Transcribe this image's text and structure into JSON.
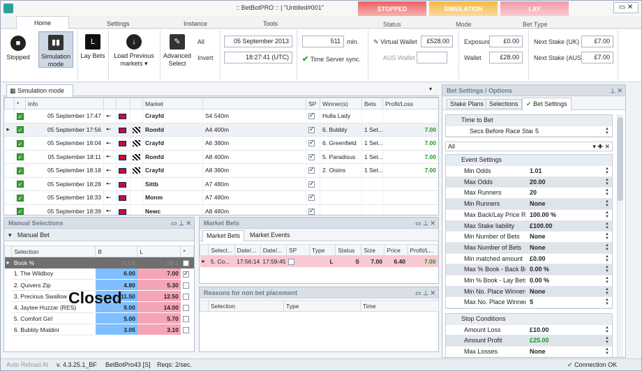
{
  "window": {
    "title": ":: BetBotPRO :: | \"Untitled#001\""
  },
  "context_tabs": [
    {
      "label": "STOPPED",
      "color": "#d94b4b",
      "group": "Status"
    },
    {
      "label": "SIMULATION",
      "color": "#f2b640",
      "group": "Mode"
    },
    {
      "label": "LAY",
      "color": "#f0a0aa",
      "group": "Bet Type"
    }
  ],
  "ribbon_tabs": [
    "Home",
    "Settings",
    "Instance",
    "Tools"
  ],
  "buttons": {
    "stopped": "Stopped",
    "simulation": "Simulation mode",
    "lay_bets": "Lay Bets",
    "load_previous": "Load Previous markets",
    "advanced_select": "Advanced Select",
    "all": "All",
    "invert": "Invert"
  },
  "datetime": {
    "date": "05 September 2013",
    "time": "18:27:41 (UTC)",
    "minutes": "511",
    "min_label": "min.",
    "time_sync": "Time Server sync."
  },
  "wallet": {
    "virtual_label": "Virtual Wallet",
    "virtual_value": "£528.00",
    "aus_label": "AUS Wallet",
    "aus_value": "",
    "exposure_label": "Exposure",
    "exposure_value": "£0.00",
    "wallet_label": "Wallet",
    "wallet_value": "£28.00"
  },
  "stake": {
    "uk_label": "Next Stake (UK)",
    "uk_value": "£7.00",
    "aus_label": "Next Stake (AUS)",
    "aus_value": "£7.00"
  },
  "markets_panel": {
    "tab": "Simulation mode",
    "headers": [
      "*",
      "Info",
      "",
      "",
      "",
      "Market",
      "",
      "SP",
      "Winner(s)",
      "Bets",
      "Profit/Loss"
    ],
    "rows": [
      {
        "info": "05 September 17:47",
        "flag2": false,
        "market": "Crayfd",
        "desc": "S4 540m",
        "sp": true,
        "winner": "Hulla Lady",
        "bets": "",
        "pl": "",
        "sel": false
      },
      {
        "info": "05 September 17:56",
        "flag2": true,
        "market": "Romfd",
        "desc": "A4 400m",
        "sp": true,
        "winner": "6. Bubbly",
        "bets": "1 Set...",
        "pl": "7.00",
        "sel": true
      },
      {
        "info": "05 September 18:04",
        "flag2": true,
        "market": "Crayfd",
        "desc": "A6 380m",
        "sp": true,
        "winner": "6. Greenfield",
        "bets": "1 Set...",
        "pl": "7.00",
        "sel": false
      },
      {
        "info": "05 September 18:11",
        "flag2": true,
        "market": "Romfd",
        "desc": "A8 400m",
        "sp": true,
        "winner": "5. Paradisus",
        "bets": "1 Set...",
        "pl": "7.00",
        "sel": false
      },
      {
        "info": "05 September 18:18",
        "flag2": true,
        "market": "Crayfd",
        "desc": "A8 380m",
        "sp": true,
        "winner": "2. Oisins",
        "bets": "1 Set...",
        "pl": "7.00",
        "sel": false
      },
      {
        "info": "05 September 18:28",
        "flag2": false,
        "market": "Sittb",
        "desc": "A7 480m",
        "sp": true,
        "winner": "",
        "bets": "",
        "pl": "",
        "sel": false
      },
      {
        "info": "05 September 18:33",
        "flag2": false,
        "market": "Monm",
        "desc": "A7 480m",
        "sp": true,
        "winner": "",
        "bets": "",
        "pl": "",
        "sel": false
      },
      {
        "info": "05 September 18:39",
        "flag2": false,
        "market": "Newc",
        "desc": "A8 480m",
        "sp": true,
        "winner": "",
        "bets": "",
        "pl": "",
        "sel": false
      }
    ]
  },
  "manual": {
    "title": "Manual Selections",
    "subtitle": "Manual Bet",
    "headers": [
      "Selection",
      "B",
      "L",
      "*"
    ],
    "book": {
      "label": "Book %",
      "b": "111.8",
      "l": "96.1"
    },
    "rows": [
      {
        "name": "1. The Wildboy",
        "b": "6.00",
        "l": "7.00",
        "checked": true
      },
      {
        "name": "2. Quivers Zip",
        "b": "4.80",
        "l": "5.30",
        "checked": false
      },
      {
        "name": "3. Precious Swallow",
        "b": "11.50",
        "l": "12.50",
        "checked": false
      },
      {
        "name": "4. Jaytee Huzzar (RES)",
        "b": "9.00",
        "l": "14.00",
        "checked": false
      },
      {
        "name": "5. Comfort Girl",
        "b": "5.00",
        "l": "5.70",
        "checked": false
      },
      {
        "name": "6. Bubbly Maldini",
        "b": "3.05",
        "l": "3.10",
        "checked": false
      }
    ],
    "overlay": "Closed"
  },
  "market_bets": {
    "title": "Market Bets",
    "tabs": [
      "Market Bets",
      "Market Events"
    ],
    "headers": [
      "Select...",
      "Date/...",
      "Date/...",
      "SP",
      "Type",
      "Status",
      "Size",
      "Price",
      "Profit/L..."
    ],
    "row": {
      "sel": "5. Co...",
      "d1": "17:56:14",
      "d2": "17:59:45",
      "type": "L",
      "status": "S",
      "size": "7.00",
      "price": "6.40",
      "pl": "7.00"
    }
  },
  "reasons": {
    "title": "Reasons for non bet placement",
    "headers": [
      "Selection",
      "Type",
      "Time"
    ]
  },
  "bet_settings": {
    "title": "Bet Settings / Options",
    "tabs": [
      "Stake Plans",
      "Selections",
      "Bet Settings"
    ],
    "time_to_bet": {
      "label": "Time to Bet",
      "k": "Secs Before Race Start",
      "v": "5"
    },
    "filter": "All",
    "event_label": "Event Settings",
    "rows": [
      {
        "k": "Min Odds",
        "v": "1.01"
      },
      {
        "k": "Max Odds",
        "v": "20.00"
      },
      {
        "k": "Max Runners",
        "v": "20"
      },
      {
        "k": "Min Runners",
        "v": "None"
      },
      {
        "k": "Max Back/Lay Price Ra",
        "v": "100.00 %"
      },
      {
        "k": "Max Stake liability",
        "v": "£100.00"
      },
      {
        "k": "Min Number of Bets",
        "v": "None"
      },
      {
        "k": "Max Number of Bets",
        "v": "None"
      },
      {
        "k": "Min matched amount",
        "v": "£0.00"
      },
      {
        "k": "Max % Book - Back Bet",
        "v": "0.00 %"
      },
      {
        "k": "Min % Book - Lay Bets",
        "v": "0.00 %"
      },
      {
        "k": "Min No. Place Winners",
        "v": "None"
      },
      {
        "k": "Max No. Place Winners",
        "v": "5"
      }
    ],
    "stop_label": "Stop Conditions",
    "stop_rows": [
      {
        "k": "Amount Loss",
        "v": "£10.00",
        "green": false
      },
      {
        "k": "Amount Profit",
        "v": "£25.00",
        "green": true
      },
      {
        "k": "Max Losses",
        "v": "None",
        "green": false
      }
    ]
  },
  "status": {
    "auto_reload": "Auto Reload At",
    "version": "v. 4.3.25.1_BF",
    "instance": "BetBotPro43 [S]",
    "reqs": "Reqs: 2/sec.",
    "connection": "Connection OK"
  }
}
